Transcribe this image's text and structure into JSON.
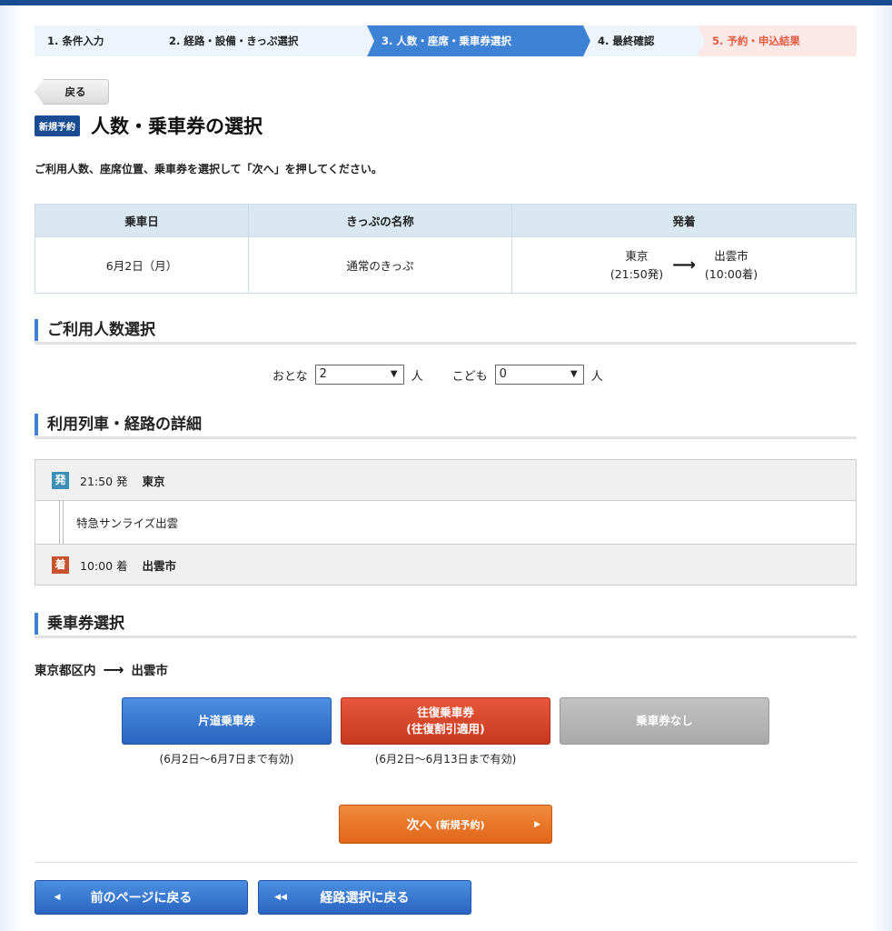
{
  "steps": [
    {
      "label": "1. 条件入力"
    },
    {
      "label": "2. 経路・設備・きっぷ選択"
    },
    {
      "label": "3. 人数・座席・乗車券選択"
    },
    {
      "label": "4. 最終確認"
    },
    {
      "label": "5. 予約・申込結果"
    }
  ],
  "back_small": "戻る",
  "badge_new": "新規予約",
  "page_title": "人数・乗車券の選択",
  "instruction": "ご利用人数、座席位置、乗車券を選択して「次へ」を押してください。",
  "summary": {
    "headers": [
      "乗車日",
      "きっぷの名称",
      "発着"
    ],
    "date": "6月2日（月）",
    "ticket_name": "通常のきっぷ",
    "dep_station": "東京",
    "dep_time": "(21:50発)",
    "arr_station": "出雲市",
    "arr_time": "(10:00着)",
    "arrow": "⟶"
  },
  "pax": {
    "heading": "ご利用人数選択",
    "adult_label": "おとな",
    "adult_value": "2",
    "child_label": "こども",
    "child_value": "0",
    "unit": "人"
  },
  "route": {
    "heading": "利用列車・経路の詳細",
    "dep_tag": "発",
    "dep_time": "21:50 発",
    "dep_station": "東京",
    "train": "特急サンライズ出雲",
    "arr_tag": "着",
    "arr_time": "10:00 着",
    "arr_station": "出雲市"
  },
  "ticket": {
    "heading": "乗車券選択",
    "from": "東京都区内",
    "arrow": "⟶",
    "to": "出雲市",
    "oneway_label": "片道乗車券",
    "round_label1": "往復乗車券",
    "round_label2": "(往復割引適用)",
    "none_label": "乗車券なし",
    "oneway_validity": "(6月2日〜6月7日まで有効)",
    "round_validity": "(6月2日〜6月13日まで有効)"
  },
  "next_button": {
    "label": "次へ",
    "sub": "(新規予約)"
  },
  "nav": {
    "prev_page": "前のページに戻る",
    "route_select": "経路選択に戻る"
  }
}
